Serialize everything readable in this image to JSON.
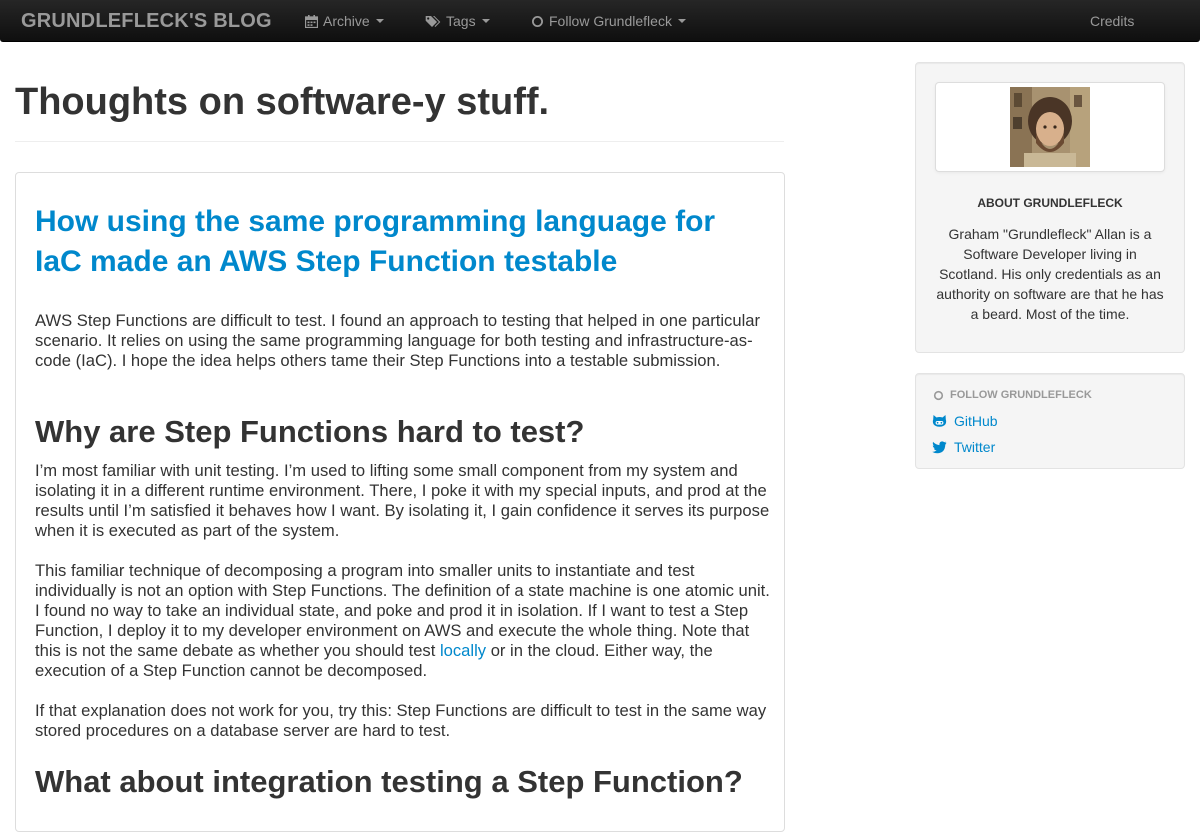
{
  "navbar": {
    "brand": "GRUNDLEFLECK'S BLOG",
    "archive_label": "Archive",
    "tags_label": "Tags",
    "follow_label": "Follow Grundlefleck",
    "credits_label": "Credits"
  },
  "main": {
    "page_title": "Thoughts on software-y stuff.",
    "post": {
      "title": "How using the same programming language for IaC made an AWS Step Function testable",
      "intro": "AWS Step Functions are difficult to test. I found an approach to testing that helped in one particular scenario. It relies on using the same programming language for both testing and infrastructure-as-code (IaC). I hope the idea helps others tame their Step Functions into a testable submission.",
      "heading_1": "Why are Step Functions hard to test?",
      "para_1": "I’m most familiar with unit testing. I’m used to lifting some small component from my system and isolating it in a different runtime environment. There, I poke it with my special inputs, and prod at the results until I’m satisfied it behaves how I want. By isolating it, I gain confidence it serves its purpose when it is executed as part of the system.",
      "para_2_before": "This familiar technique of decomposing a program into smaller units to instantiate and test individually is not an option with Step Functions. The definition of a state machine is one atomic unit. I found no way to take an individual state, and poke and prod it in isolation. If I want to test a Step Function, I deploy it to my developer environment on AWS and execute the whole thing. Note that this is not the same debate as whether you should test ",
      "para_2_link": "locally",
      "para_2_after": " or in the cloud. Either way, the execution of a Step Function cannot be decomposed.",
      "para_3": "If that explanation does not work for you, try this: Step Functions are difficult to test in the same way stored procedures on a database server are hard to test.",
      "heading_2": "What about integration testing a Step Function?"
    }
  },
  "sidebar": {
    "about_heading": "ABOUT GRUNDLEFLECK",
    "about_text": "Graham \"Grundlefleck\" Allan is a Software Developer living in Scotland. His only credentials as an authority on software are that he has a beard. Most of the time.",
    "follow_heading": "FOLLOW GRUNDLEFLECK",
    "links": [
      {
        "label": "GitHub",
        "icon": "github-icon"
      },
      {
        "label": "Twitter",
        "icon": "twitter-icon"
      }
    ]
  },
  "colors": {
    "link": "#0088cc",
    "navbar_text": "#999999",
    "body_text": "#333333",
    "well_bg": "#f5f5f5"
  }
}
